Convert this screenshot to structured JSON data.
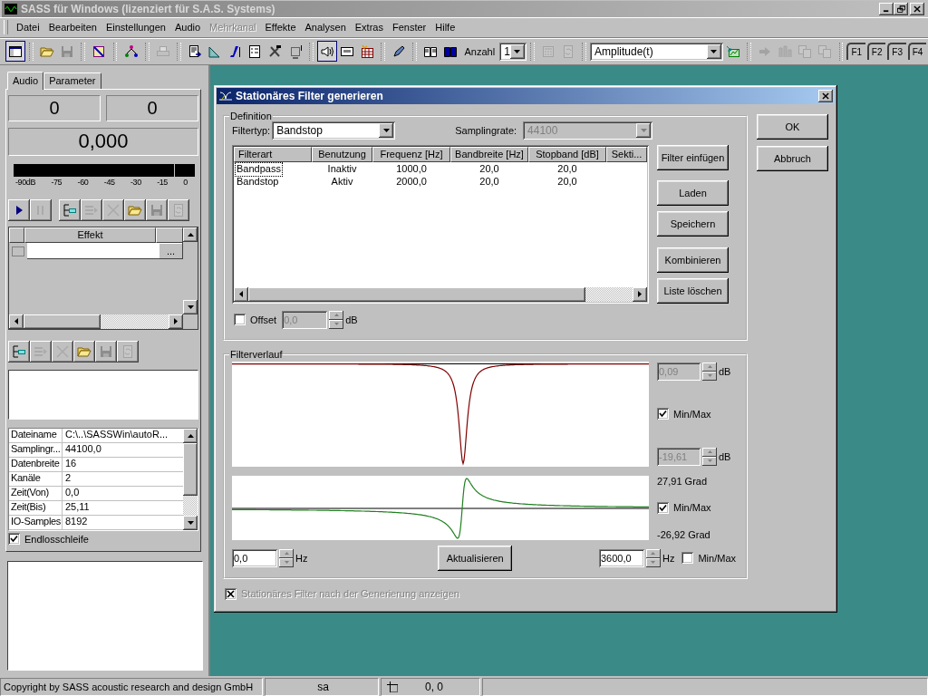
{
  "window": {
    "title": "SASS für Windows (lizenziert für S.A.S. Systems)"
  },
  "menu": [
    {
      "label": "Datei",
      "disabled": false
    },
    {
      "label": "Bearbeiten",
      "disabled": false
    },
    {
      "label": "Einstellungen",
      "disabled": false
    },
    {
      "label": "Audio",
      "disabled": false
    },
    {
      "label": "Mehrkanal",
      "disabled": true
    },
    {
      "label": "Effekte",
      "disabled": false
    },
    {
      "label": "Analysen",
      "disabled": false
    },
    {
      "label": "Extras",
      "disabled": false
    },
    {
      "label": "Fenster",
      "disabled": false
    },
    {
      "label": "Hilfe",
      "disabled": false
    }
  ],
  "toolbar": [
    {
      "kind": "icon",
      "disabled": false,
      "pressed": true
    },
    {
      "kind": "separator"
    },
    {
      "kind": "icon",
      "disabled": false,
      "pressed": false
    },
    {
      "kind": "icon",
      "disabled": true,
      "pressed": false
    },
    {
      "kind": "separator"
    },
    {
      "kind": "icon",
      "disabled": false,
      "pressed": false
    },
    {
      "kind": "separator"
    },
    {
      "kind": "icon",
      "disabled": false,
      "pressed": false
    },
    {
      "kind": "separator"
    },
    {
      "kind": "icon",
      "disabled": true,
      "pressed": false
    },
    {
      "kind": "separator"
    },
    {
      "kind": "icon",
      "disabled": false,
      "pressed": false
    },
    {
      "kind": "icon",
      "disabled": false,
      "pressed": false
    },
    {
      "kind": "icon",
      "disabled": false,
      "pressed": false
    },
    {
      "kind": "icon",
      "disabled": false,
      "pressed": false
    },
    {
      "kind": "icon",
      "disabled": false,
      "pressed": false
    },
    {
      "kind": "icon",
      "disabled": false,
      "pressed": false
    },
    {
      "kind": "separator"
    },
    {
      "kind": "icon",
      "disabled": false,
      "pressed": true
    },
    {
      "kind": "icon",
      "disabled": false,
      "pressed": false
    },
    {
      "kind": "icon",
      "disabled": false,
      "pressed": false
    },
    {
      "kind": "separator"
    },
    {
      "kind": "icon",
      "disabled": false,
      "pressed": false
    },
    {
      "kind": "separator"
    },
    {
      "kind": "icon",
      "disabled": false,
      "pressed": false
    },
    {
      "kind": "icon",
      "disabled": false,
      "pressed": false
    },
    {
      "kind": "count",
      "label": "Anzahl",
      "value": "1"
    },
    {
      "kind": "separator"
    },
    {
      "kind": "icon",
      "disabled": true,
      "pressed": false
    },
    {
      "kind": "icon",
      "disabled": true,
      "pressed": false
    },
    {
      "kind": "separator"
    },
    {
      "kind": "combo",
      "value": "Amplitude(t)"
    },
    {
      "kind": "icon",
      "disabled": false,
      "pressed": false
    },
    {
      "kind": "separator"
    },
    {
      "kind": "icon",
      "disabled": true,
      "pressed": false
    },
    {
      "kind": "icon",
      "disabled": true,
      "pressed": false
    },
    {
      "kind": "icon",
      "disabled": true,
      "pressed": false
    },
    {
      "kind": "icon",
      "disabled": true,
      "pressed": false
    },
    {
      "kind": "separator"
    },
    {
      "kind": "fkey",
      "label": "F1"
    },
    {
      "kind": "fkey",
      "label": "F2"
    },
    {
      "kind": "fkey",
      "label": "F3"
    },
    {
      "kind": "fkey",
      "label": "F4"
    }
  ],
  "left_panel": {
    "tabs": [
      {
        "label": "Audio",
        "selected": true
      },
      {
        "label": "Parameter",
        "selected": false
      }
    ],
    "counters": [
      "0",
      "0"
    ],
    "time": "0,000",
    "meter_scale": [
      "-90dB",
      "-75",
      "-60",
      "-45",
      "-30",
      "-15",
      "0"
    ],
    "transport": [
      {
        "disabled": false
      },
      {
        "disabled": true
      },
      {
        "disabled": false
      },
      {
        "disabled": true
      },
      {
        "disabled": true
      },
      {
        "disabled": false
      },
      {
        "disabled": true
      },
      {
        "disabled": true
      }
    ],
    "effects_grid": {
      "column": "Effekt",
      "row_button": "..."
    },
    "effect_tools": [
      {
        "disabled": false
      },
      {
        "disabled": true
      },
      {
        "disabled": true
      },
      {
        "disabled": false
      },
      {
        "disabled": true
      },
      {
        "disabled": true
      }
    ],
    "properties": [
      {
        "name": "Dateiname",
        "value": "C:\\..\\SASSWin\\autoR..."
      },
      {
        "name": "Samplingr...",
        "value": "44100,0"
      },
      {
        "name": "Datenbreite",
        "value": "16"
      },
      {
        "name": "Kanäle",
        "value": "2"
      },
      {
        "name": "Zeit(Von)",
        "value": "0,0"
      },
      {
        "name": "Zeit(Bis)",
        "value": "25,11"
      },
      {
        "name": "IO-Samples",
        "value": "8192"
      }
    ],
    "loop": {
      "label": "Endlosschleife",
      "checked": true
    }
  },
  "dialog": {
    "title": "Stationäres Filter generieren",
    "definition": {
      "legend": "Definition",
      "filter_type": {
        "label": "Filtertyp:",
        "value": "Bandstop"
      },
      "sampling_rate": {
        "label": "Samplingrate:",
        "value": "44100",
        "disabled": true
      },
      "columns": [
        "Filterart",
        "Benutzung",
        "Frequenz [Hz]",
        "Bandbreite [Hz]",
        "Stopband [dB]",
        "Sekti..."
      ],
      "rows": [
        {
          "cells": [
            "Bandpass",
            "Inaktiv",
            "1000,0",
            "20,0",
            "20,0"
          ],
          "focused": true
        },
        {
          "cells": [
            "Bandstop",
            "Aktiv",
            "2000,0",
            "20,0",
            "20,0"
          ],
          "focused": false
        }
      ],
      "buttons": [
        "Filter einfügen",
        "Laden",
        "Speichern",
        "Kombinieren",
        "Liste löschen"
      ],
      "offset": {
        "label": "Offset",
        "checked": false,
        "value": "0,0",
        "unit": "dB",
        "disabled": true
      }
    },
    "buttons": [
      "OK",
      "Abbruch"
    ],
    "response": {
      "legend": "Filterverlauf",
      "magnitude_max": {
        "value": "0,09",
        "unit": "dB",
        "disabled": true
      },
      "magnitude_minmax": {
        "label": "Min/Max",
        "checked": true
      },
      "magnitude_min": {
        "value": "-19,61",
        "unit": "dB",
        "disabled": true
      },
      "phase_max": "27,91 Grad",
      "phase_minmax": {
        "label": "Min/Max",
        "checked": true
      },
      "phase_min": "-26,92 Grad",
      "from": {
        "value": "0,0",
        "unit": "Hz"
      },
      "update_button": "Aktualisieren",
      "to": {
        "value": "3600,0",
        "unit": "Hz"
      },
      "range_minmax": {
        "label": "Min/Max",
        "checked": false
      }
    },
    "show_after": {
      "label": "Stationäres Filter nach der Generierung anzeigen",
      "checked": true,
      "disabled": true
    }
  },
  "status_bar": {
    "copyright": "Copyright by SASS acoustic research and design GmbH",
    "user": "sa",
    "position": "0, 0"
  }
}
